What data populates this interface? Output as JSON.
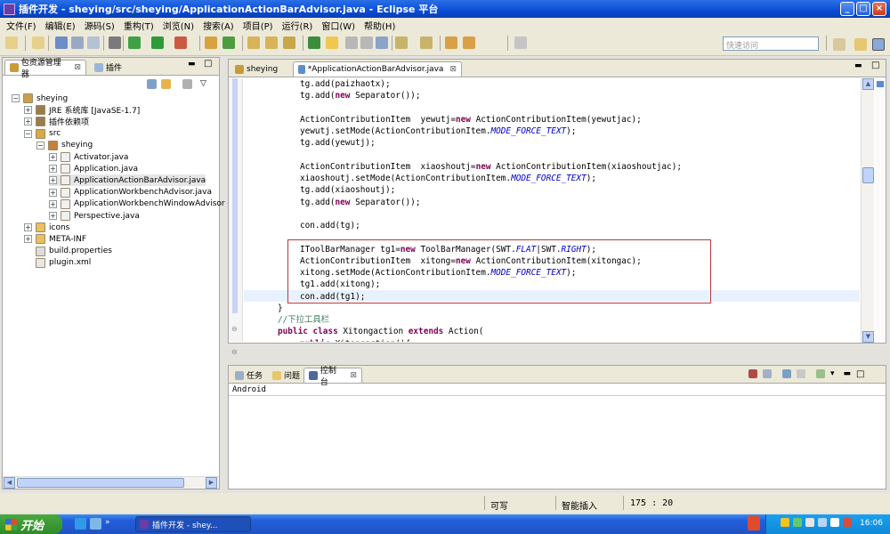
{
  "window": {
    "title": "插件开发 - sheying/src/sheying/ApplicationActionBarAdvisor.java - Eclipse 平台"
  },
  "menu": [
    "文件(F)",
    "编辑(E)",
    "源码(S)",
    "重构(T)",
    "浏览(N)",
    "搜索(A)",
    "项目(P)",
    "运行(R)",
    "窗口(W)",
    "帮助(H)"
  ],
  "quick_access": "快速访问",
  "left_panel": {
    "tabs": [
      "包资源管理器",
      "插件"
    ],
    "tree": [
      {
        "label": "sheying",
        "depth": 0,
        "toggle": "−",
        "icon": "project-icon"
      },
      {
        "label": "JRE 系统库 [JavaSE-1.7]",
        "depth": 1,
        "toggle": "+",
        "icon": "library-icon"
      },
      {
        "label": "插件依赖项",
        "depth": 1,
        "toggle": "+",
        "icon": "library-icon"
      },
      {
        "label": "src",
        "depth": 1,
        "toggle": "−",
        "icon": "source-folder-icon"
      },
      {
        "label": "sheying",
        "depth": 2,
        "toggle": "−",
        "icon": "package-icon"
      },
      {
        "label": "Activator.java",
        "depth": 3,
        "toggle": "+",
        "icon": "java-file-icon"
      },
      {
        "label": "Application.java",
        "depth": 3,
        "toggle": "+",
        "icon": "java-file-icon"
      },
      {
        "label": "ApplicationActionBarAdvisor.java",
        "depth": 3,
        "toggle": "+",
        "icon": "java-file-icon"
      },
      {
        "label": "ApplicationWorkbenchAdvisor.java",
        "depth": 3,
        "toggle": "+",
        "icon": "java-file-icon"
      },
      {
        "label": "ApplicationWorkbenchWindowAdvisor",
        "depth": 3,
        "toggle": "+",
        "icon": "java-file-icon"
      },
      {
        "label": "Perspective.java",
        "depth": 3,
        "toggle": "+",
        "icon": "java-file-icon"
      },
      {
        "label": "icons",
        "depth": 1,
        "toggle": "+",
        "icon": "folder-icon"
      },
      {
        "label": "META-INF",
        "depth": 1,
        "toggle": "+",
        "icon": "folder-icon"
      },
      {
        "label": "build.properties",
        "depth": 1,
        "toggle": "",
        "icon": "properties-file-icon"
      },
      {
        "label": "plugin.xml",
        "depth": 1,
        "toggle": "",
        "icon": "xml-file-icon"
      }
    ]
  },
  "editor": {
    "tabs": [
      "sheying",
      "*ApplicationActionBarAdvisor.java"
    ],
    "lines": [
      {
        "indent": 2,
        "parts": [
          [
            "n",
            "tg.add(paizhaotx);"
          ]
        ]
      },
      {
        "indent": 2,
        "parts": [
          [
            "n",
            "tg.add("
          ],
          [
            "k",
            "new"
          ],
          [
            "n",
            " Separator());"
          ]
        ]
      },
      {
        "indent": 0,
        "parts": []
      },
      {
        "indent": 2,
        "parts": [
          [
            "n",
            "ActionContributionItem  yewutj="
          ],
          [
            "k",
            "new"
          ],
          [
            "n",
            " ActionContributionItem(yewutjac);"
          ]
        ]
      },
      {
        "indent": 2,
        "parts": [
          [
            "n",
            "yewutj.setMode(ActionContributionItem."
          ],
          [
            "i",
            "MODE_FORCE_TEXT"
          ],
          [
            "n",
            ");"
          ]
        ]
      },
      {
        "indent": 2,
        "parts": [
          [
            "n",
            "tg.add(yewutj);"
          ]
        ]
      },
      {
        "indent": 0,
        "parts": []
      },
      {
        "indent": 2,
        "parts": [
          [
            "n",
            "ActionContributionItem  xiaoshoutj="
          ],
          [
            "k",
            "new"
          ],
          [
            "n",
            " ActionContributionItem(xiaoshoutjac);"
          ]
        ]
      },
      {
        "indent": 2,
        "parts": [
          [
            "n",
            "xiaoshoutj.setMode(ActionContributionItem."
          ],
          [
            "i",
            "MODE_FORCE_TEXT"
          ],
          [
            "n",
            ");"
          ]
        ]
      },
      {
        "indent": 2,
        "parts": [
          [
            "n",
            "tg.add(xiaoshoutj);"
          ]
        ]
      },
      {
        "indent": 2,
        "parts": [
          [
            "n",
            "tg.add("
          ],
          [
            "k",
            "new"
          ],
          [
            "n",
            " Separator());"
          ]
        ]
      },
      {
        "indent": 0,
        "parts": []
      },
      {
        "indent": 2,
        "parts": [
          [
            "n",
            "con.add(tg);"
          ]
        ]
      },
      {
        "indent": 0,
        "parts": []
      },
      {
        "indent": 2,
        "parts": [
          [
            "n",
            "IToolBarManager tg1="
          ],
          [
            "k",
            "new"
          ],
          [
            "n",
            " ToolBarManager(SWT."
          ],
          [
            "i",
            "FLAT"
          ],
          [
            "n",
            "|SWT."
          ],
          [
            "i",
            "RIGHT"
          ],
          [
            "n",
            ");"
          ]
        ]
      },
      {
        "indent": 2,
        "parts": [
          [
            "n",
            "ActionContributionItem  xitong="
          ],
          [
            "k",
            "new"
          ],
          [
            "n",
            " ActionContributionItem(xitongac);"
          ]
        ]
      },
      {
        "indent": 2,
        "parts": [
          [
            "n",
            "xitong.setMode(ActionContributionItem."
          ],
          [
            "i",
            "MODE_FORCE_TEXT"
          ],
          [
            "n",
            ");"
          ]
        ]
      },
      {
        "indent": 2,
        "parts": [
          [
            "n",
            "tg1.add(xitong);"
          ]
        ]
      },
      {
        "indent": 2,
        "parts": [
          [
            "n",
            "con.add(tg1);"
          ]
        ]
      },
      {
        "indent": 1,
        "parts": [
          [
            "n",
            "}"
          ]
        ]
      },
      {
        "indent": 1,
        "parts": [
          [
            "c",
            "//下拉工具栏"
          ]
        ]
      },
      {
        "indent": 1,
        "parts": [
          [
            "k",
            "public class"
          ],
          [
            "n",
            " Xitongaction "
          ],
          [
            "k",
            "extends"
          ],
          [
            "n",
            " Action("
          ]
        ]
      },
      {
        "indent": 2,
        "parts": [
          [
            "k",
            "public"
          ],
          [
            "n",
            " Xitongaction(){"
          ]
        ]
      }
    ]
  },
  "bottom_panel": {
    "tabs": [
      "任务",
      "问题",
      "控制台"
    ],
    "console_text": "Android"
  },
  "status_bar": {
    "writable": "可写",
    "insert_mode": "智能插入",
    "position": "175 : 20"
  },
  "taskbar": {
    "start": "开始",
    "task": "插件开发 - shey...",
    "clock": "16:06"
  },
  "colors": {
    "keyword": "#7f0055",
    "constant": "#0000c0",
    "comment": "#3f7f5f",
    "highlight_box": "#b53a3a",
    "title_bar": "#0a4cd6"
  }
}
